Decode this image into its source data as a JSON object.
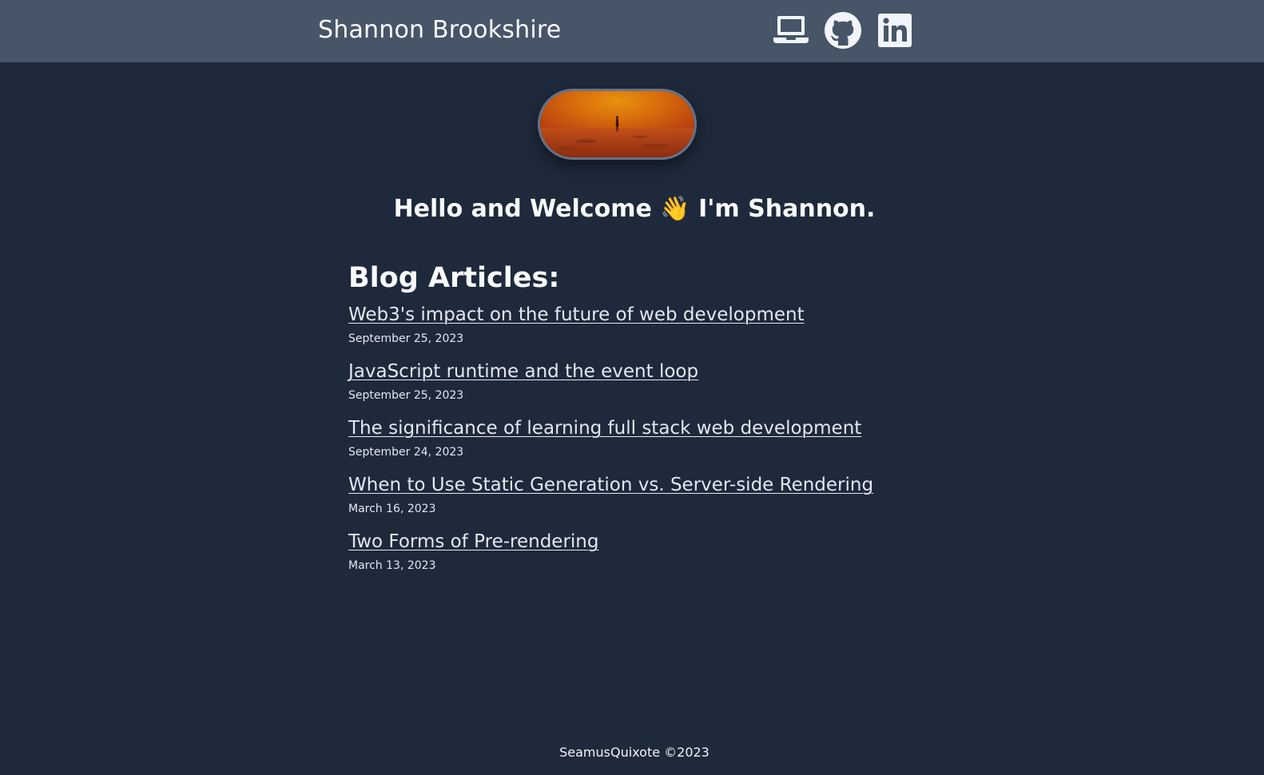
{
  "header": {
    "site_title": "Shannon Brookshire",
    "icons": [
      {
        "name": "laptop-icon"
      },
      {
        "name": "github-icon"
      },
      {
        "name": "linkedin-icon"
      }
    ]
  },
  "hero": {
    "image_name": "desert-figure-banner"
  },
  "greeting": {
    "prefix": "Hello and Welcome ",
    "emoji": "👋",
    "mid": " I'm ",
    "name": "Shannon",
    "suffix": "."
  },
  "blog": {
    "heading": "Blog Articles:",
    "articles": [
      {
        "title": "Web3's impact on the future of web development",
        "date": "September 25, 2023"
      },
      {
        "title": "JavaScript runtime and the event loop",
        "date": "September 25, 2023"
      },
      {
        "title": "The significance of learning full stack web development",
        "date": "September 24, 2023"
      },
      {
        "title": "When to Use Static Generation vs. Server-side Rendering",
        "date": "March 16, 2023"
      },
      {
        "title": "Two Forms of Pre-rendering",
        "date": "March 13, 2023"
      }
    ]
  },
  "footer": {
    "text": "SeamusQuixote ©2023"
  },
  "colors": {
    "background": "#1e293b",
    "navbar": "#475569",
    "text": "#f1f5f9"
  }
}
